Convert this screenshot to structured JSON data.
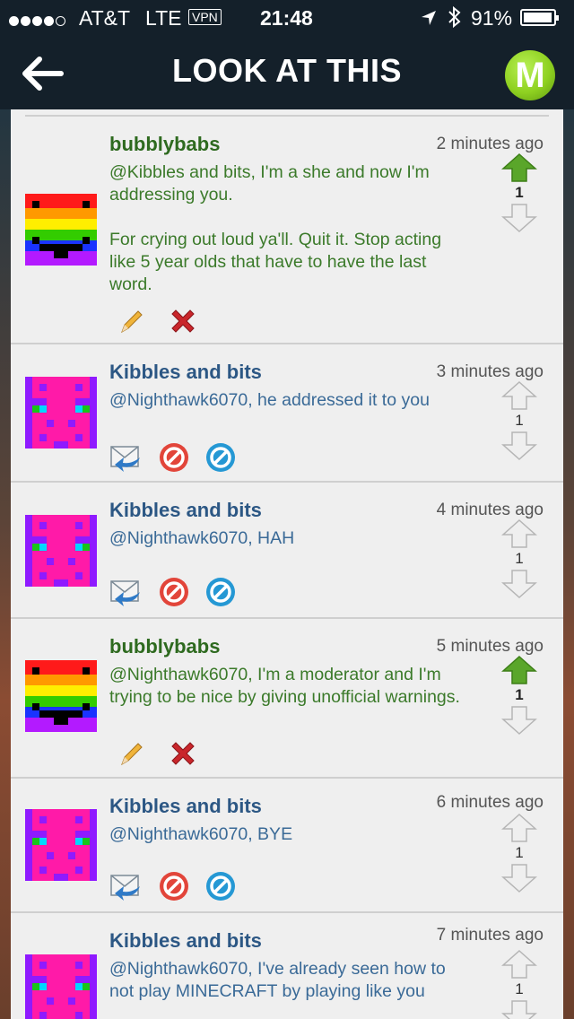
{
  "status_bar": {
    "carrier": "AT&T",
    "network": "LTE",
    "vpn": "VPN",
    "time": "21:48",
    "battery": "91%"
  },
  "nav": {
    "title": "LOOK AT THIS",
    "logo_letter": "M"
  },
  "comments": [
    {
      "username": "bubblybabs",
      "time": "2 minutes ago",
      "lines": [
        "@Kibbles and bits, I'm a she and now I'm addressing you.",
        "For crying out loud ya'll. Quit it. Stop acting like 5 year olds that have to have the last word."
      ],
      "votes": "1",
      "role": "mod"
    },
    {
      "username": "Kibbles and bits",
      "time": "3 minutes ago",
      "lines": [
        "@Nighthawk6070, he addressed it to you"
      ],
      "votes": "1",
      "role": "user"
    },
    {
      "username": "Kibbles and bits",
      "time": "4 minutes ago",
      "lines": [
        "@Nighthawk6070, HAH"
      ],
      "votes": "1",
      "role": "user"
    },
    {
      "username": "bubblybabs",
      "time": "5 minutes ago",
      "lines": [
        "@Nighthawk6070, I'm a moderator and I'm trying to be nice by giving unofficial warnings."
      ],
      "votes": "1",
      "role": "mod"
    },
    {
      "username": "Kibbles and bits",
      "time": "6 minutes ago",
      "lines": [
        "@Nighthawk6070, BYE"
      ],
      "votes": "1",
      "role": "user"
    },
    {
      "username": "Kibbles and bits",
      "time": "7 minutes ago",
      "lines": [
        "@Nighthawk6070, I've already seen how to not play MINECRAFT by playing like you"
      ],
      "votes": "1",
      "role": "user"
    }
  ],
  "colors": {
    "mod_name": "#2e6a1f",
    "user_name": "#2c5784",
    "upvote_active": "#5aa62a",
    "nav_bg": "#14202a"
  }
}
